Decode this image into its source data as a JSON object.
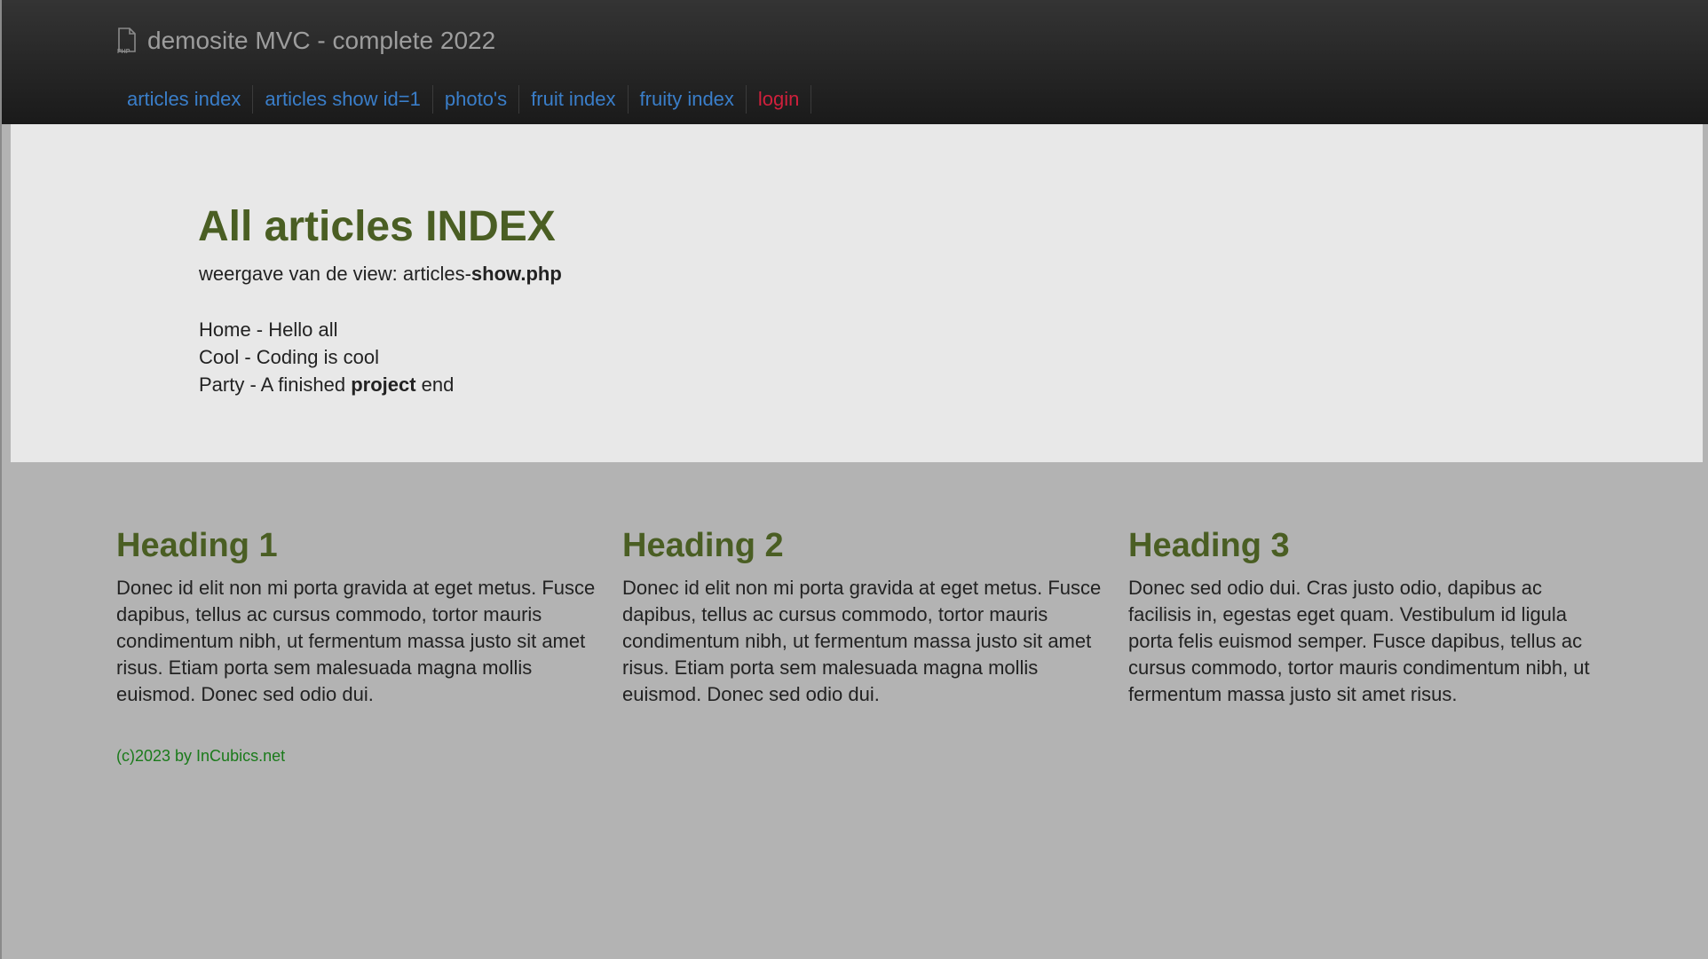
{
  "navbar": {
    "brand_icon": "php-file-icon",
    "brand_text": "demosite MVC - complete 2022",
    "items": [
      {
        "label": "articles index"
      },
      {
        "label": "articles show id=1"
      },
      {
        "label": "photo's"
      },
      {
        "label": "fruit index"
      },
      {
        "label": "fruity index"
      },
      {
        "label": "login"
      }
    ]
  },
  "hero": {
    "title": "All articles INDEX",
    "subtitle_prefix": "weergave van de view: articles-",
    "subtitle_bold": "show.php",
    "articles": [
      {
        "text": "Home - Hello all"
      },
      {
        "text": "Cool - Coding is cool"
      },
      {
        "prefix": "Party - A finished ",
        "bold": "project",
        "suffix": " end"
      }
    ]
  },
  "columns": [
    {
      "heading": "Heading 1",
      "body": "Donec id elit non mi porta gravida at eget metus. Fusce dapibus, tellus ac cursus commodo, tortor mauris condimentum nibh, ut fermentum massa justo sit amet risus. Etiam porta sem malesuada magna mollis euismod. Donec sed odio dui."
    },
    {
      "heading": "Heading 2",
      "body": "Donec id elit non mi porta gravida at eget metus. Fusce dapibus, tellus ac cursus commodo, tortor mauris condimentum nibh, ut fermentum massa justo sit amet risus. Etiam porta sem malesuada magna mollis euismod. Donec sed odio dui."
    },
    {
      "heading": "Heading 3",
      "body": "Donec sed odio dui. Cras justo odio, dapibus ac facilisis in, egestas eget quam. Vestibulum id ligula porta felis euismod semper. Fusce dapibus, tellus ac cursus commodo, tortor mauris condimentum nibh, ut fermentum massa justo sit amet risus."
    }
  ],
  "footer": {
    "text": "(c)2023 by InCubics.net"
  },
  "colors": {
    "heading_green": "#4a5e23",
    "link_blue": "#3a7ec9",
    "login_red": "#d0203c",
    "footer_green": "#1a7a1a"
  }
}
